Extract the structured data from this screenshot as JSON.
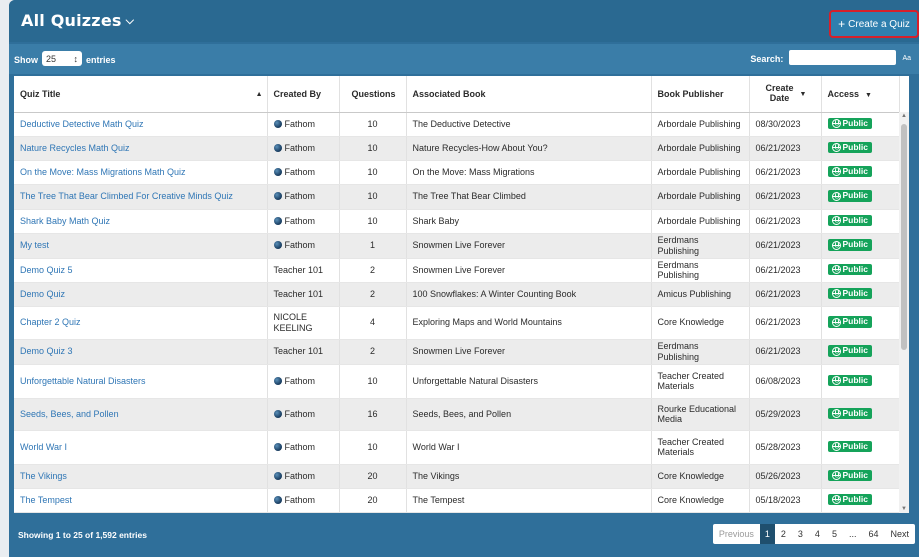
{
  "header": {
    "title": "All Quizzes",
    "create_button": "Create a Quiz"
  },
  "controls": {
    "show_label": "Show",
    "entries_value": "25",
    "entries_label": "entries",
    "search_label": "Search:",
    "search_value": "",
    "aa": "Aa"
  },
  "columns": {
    "quiz_title": "Quiz Title",
    "created_by": "Created By",
    "questions": "Questions",
    "associated_book": "Associated Book",
    "book_publisher": "Book Publisher",
    "create_date_line1": "Create",
    "create_date_line2": "Date",
    "access": "Access"
  },
  "rows": [
    {
      "title": "Deductive Detective Math Quiz",
      "creator": "Fathom",
      "creator_icon": true,
      "questions": "10",
      "book": "The Deductive Detective",
      "publisher": "Arbordale Publishing",
      "date": "08/30/2023",
      "access": "Public"
    },
    {
      "title": "Nature Recycles Math Quiz",
      "creator": "Fathom",
      "creator_icon": true,
      "questions": "10",
      "book": "Nature Recycles-How About You?",
      "publisher": "Arbordale Publishing",
      "date": "06/21/2023",
      "access": "Public"
    },
    {
      "title": "On the Move: Mass Migrations Math Quiz",
      "creator": "Fathom",
      "creator_icon": true,
      "questions": "10",
      "book": "On the Move: Mass Migrations",
      "publisher": "Arbordale Publishing",
      "date": "06/21/2023",
      "access": "Public"
    },
    {
      "title": "The Tree That Bear Climbed For Creative Minds Quiz",
      "creator": "Fathom",
      "creator_icon": true,
      "questions": "10",
      "book": "The Tree That Bear Climbed",
      "publisher": "Arbordale Publishing",
      "date": "06/21/2023",
      "access": "Public"
    },
    {
      "title": "Shark Baby Math Quiz",
      "creator": "Fathom",
      "creator_icon": true,
      "questions": "10",
      "book": "Shark Baby",
      "publisher": "Arbordale Publishing",
      "date": "06/21/2023",
      "access": "Public"
    },
    {
      "title": "My test",
      "creator": "Fathom",
      "creator_icon": true,
      "questions": "1",
      "book": "Snowmen Live Forever",
      "publisher": "Eerdmans Publishing",
      "date": "06/21/2023",
      "access": "Public"
    },
    {
      "title": "Demo Quiz 5",
      "creator": "Teacher 101",
      "creator_icon": false,
      "questions": "2",
      "book": "Snowmen Live Forever",
      "publisher": "Eerdmans Publishing",
      "date": "06/21/2023",
      "access": "Public"
    },
    {
      "title": "Demo Quiz",
      "creator": "Teacher 101",
      "creator_icon": false,
      "questions": "2",
      "book": "100 Snowflakes: A Winter Counting Book",
      "publisher": "Amicus Publishing",
      "date": "06/21/2023",
      "access": "Public"
    },
    {
      "title": "Chapter 2 Quiz",
      "creator": "NICOLE KEELING",
      "creator_icon": false,
      "questions": "4",
      "book": "Exploring Maps and World Mountains",
      "publisher": "Core Knowledge",
      "date": "06/21/2023",
      "access": "Public"
    },
    {
      "title": "Demo Quiz 3",
      "creator": "Teacher 101",
      "creator_icon": false,
      "questions": "2",
      "book": "Snowmen Live Forever",
      "publisher": "Eerdmans Publishing",
      "date": "06/21/2023",
      "access": "Public"
    },
    {
      "title": "Unforgettable Natural Disasters",
      "creator": "Fathom",
      "creator_icon": true,
      "questions": "10",
      "book": "Unforgettable Natural Disasters",
      "publisher": "Teacher Created Materials",
      "date": "06/08/2023",
      "access": "Public"
    },
    {
      "title": "Seeds, Bees, and Pollen",
      "creator": "Fathom",
      "creator_icon": true,
      "questions": "16",
      "book": "Seeds, Bees, and Pollen",
      "publisher": "Rourke Educational Media",
      "date": "05/29/2023",
      "access": "Public"
    },
    {
      "title": "World War I",
      "creator": "Fathom",
      "creator_icon": true,
      "questions": "10",
      "book": "World War I",
      "publisher": "Teacher Created Materials",
      "date": "05/28/2023",
      "access": "Public"
    },
    {
      "title": "The Vikings",
      "creator": "Fathom",
      "creator_icon": true,
      "questions": "20",
      "book": "The Vikings",
      "publisher": "Core Knowledge",
      "date": "05/26/2023",
      "access": "Public"
    },
    {
      "title": "The Tempest",
      "creator": "Fathom",
      "creator_icon": true,
      "questions": "20",
      "book": "The Tempest",
      "publisher": "Core Knowledge",
      "date": "05/18/2023",
      "access": "Public"
    }
  ],
  "footer": {
    "info": "Showing 1 to 25 of 1,592 entries",
    "previous": "Previous",
    "pages": [
      "1",
      "2",
      "3",
      "4",
      "5",
      "...",
      "64"
    ],
    "next": "Next"
  },
  "colors": {
    "brand": "#2f6f9a",
    "public_badge": "#15a35a",
    "link": "#2f76b5",
    "highlight": "#d6202b"
  }
}
